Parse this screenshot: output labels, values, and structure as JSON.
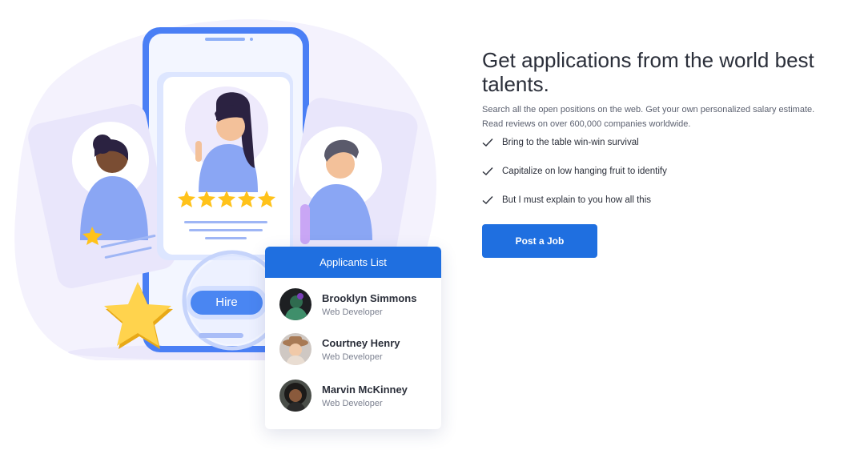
{
  "hero": {
    "headline": "Get applications from the world best talents.",
    "description": "Search all the open positions on the web. Get your own personalized salary estimate. Read reviews on over 600,000 companies worldwide.",
    "features": [
      "Bring to the table win-win survival",
      "Capitalize on low hanging fruit to identify",
      "But I must explain to you how all this"
    ],
    "cta_label": "Post a Job"
  },
  "illustration": {
    "hire_label": "Hire",
    "profile_rating_stars": 5
  },
  "applicants": {
    "title": "Applicants List",
    "items": [
      {
        "name": "Brooklyn Simmons",
        "role": "Web Developer"
      },
      {
        "name": "Courtney Henry",
        "role": "Web Developer"
      },
      {
        "name": "Marvin McKinney",
        "role": "Web Developer"
      }
    ]
  },
  "colors": {
    "primary": "#1f6fe0",
    "illustration_blue": "#4a86f2",
    "illustration_lavender": "#eeeafc",
    "star": "#ffc21a"
  }
}
